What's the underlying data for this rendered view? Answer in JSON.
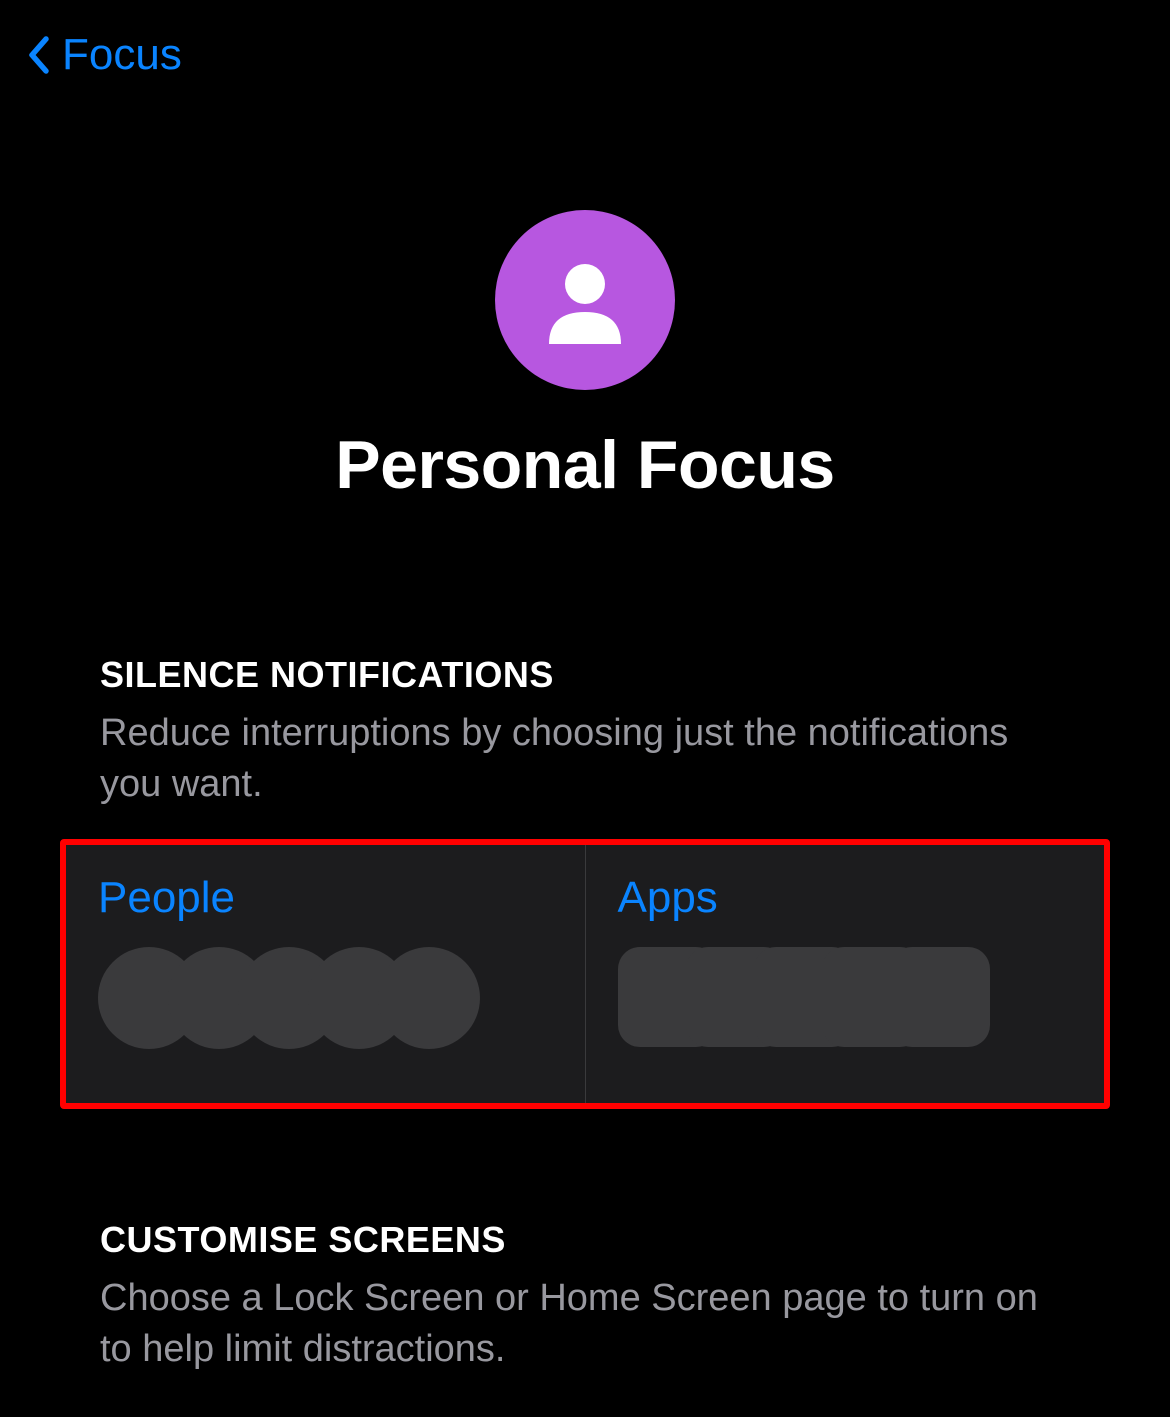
{
  "nav": {
    "back_label": "Focus"
  },
  "header": {
    "title": "Personal Focus",
    "icon_color": "#b757e0"
  },
  "sections": {
    "silence": {
      "heading": "SILENCE NOTIFICATIONS",
      "description": "Reduce interruptions by choosing just the notifications you want.",
      "cards": {
        "people_label": "People",
        "apps_label": "Apps"
      }
    },
    "customise": {
      "heading": "CUSTOMISE SCREENS",
      "description": "Choose a Lock Screen or Home Screen page to turn on to help limit distractions."
    }
  },
  "colors": {
    "accent": "#0a84ff",
    "secondary_text": "#98989f",
    "card_bg": "#1c1c1e",
    "placeholder": "#3a3a3c",
    "highlight_border": "#ff0000"
  }
}
